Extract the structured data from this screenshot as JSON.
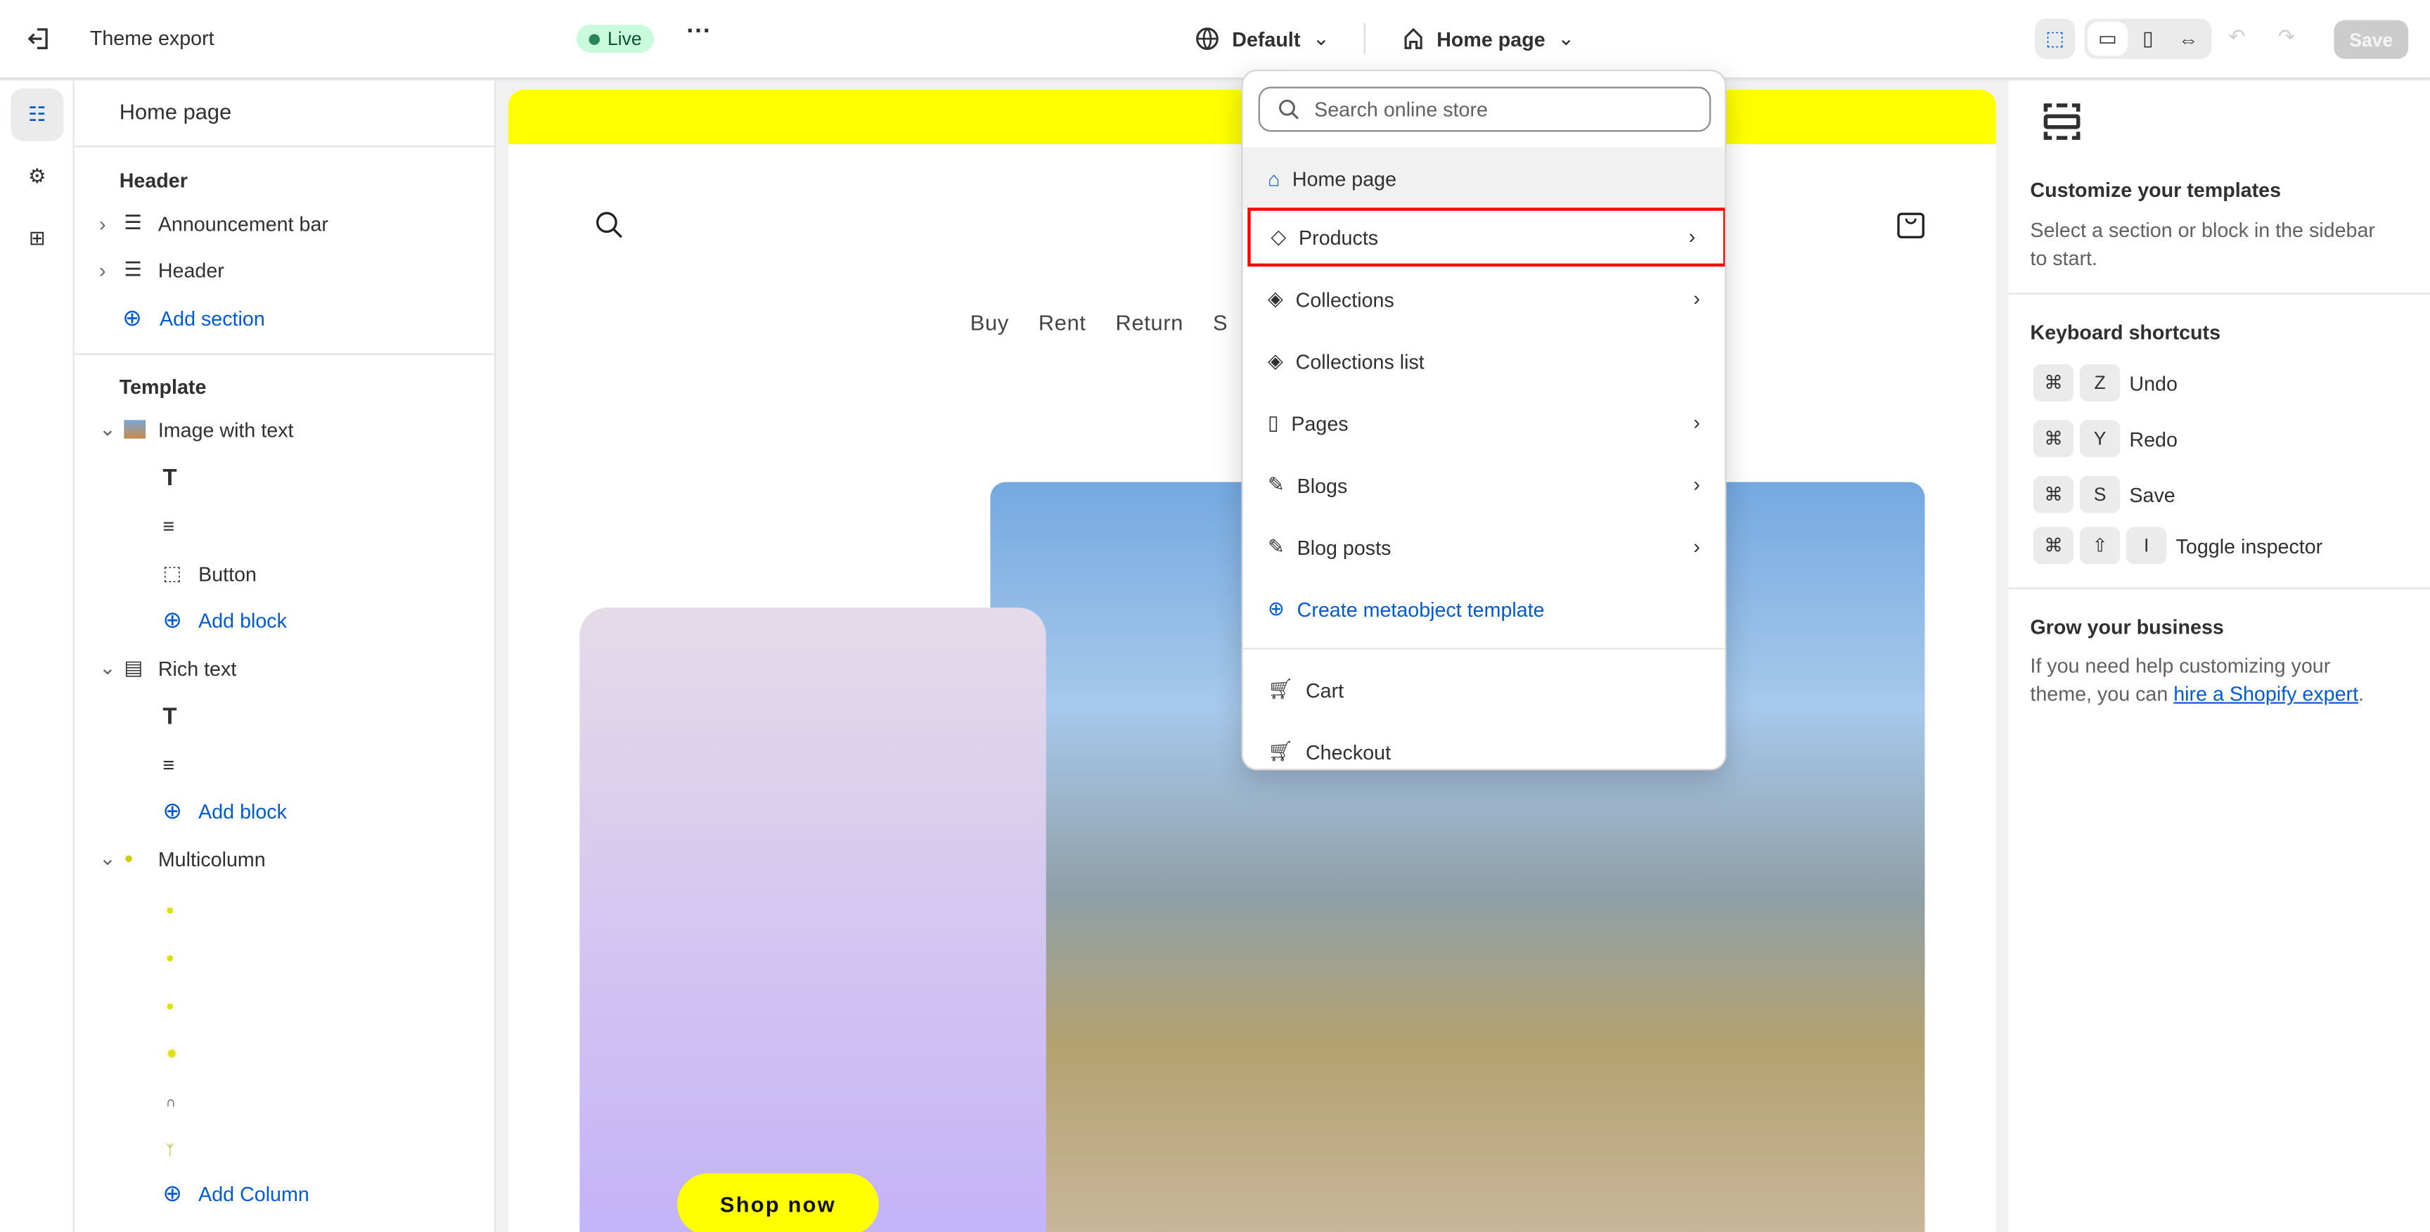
{
  "topbar": {
    "exit_icon": "exit-icon",
    "theme_name": "Theme export",
    "status": "Live",
    "more_icon": "ellipsis-icon",
    "locale": "Default",
    "template": "Home page",
    "save": "Save",
    "tools": [
      "inspector-icon",
      "desktop-icon",
      "mobile-icon",
      "fullwidth-icon",
      "undo-icon",
      "redo-icon"
    ]
  },
  "rail": {
    "items": [
      "sections-icon",
      "settings-icon",
      "apps-icon"
    ]
  },
  "sidebar": {
    "title": "Home page",
    "header_group": "Header",
    "header_items": [
      "Announcement bar",
      "Header"
    ],
    "add_section": "Add section",
    "template_group": "Template",
    "image_with_text": "Image with text",
    "iwt_blocks": [
      "heading-icon",
      "text-icon",
      "Button"
    ],
    "add_block": "Add block",
    "rich_text": "Rich text",
    "rt_blocks": [
      "heading-icon",
      "text-icon"
    ],
    "multicolumn": "Multicolumn",
    "columns": [
      "dollar-coin-icon",
      "check-circle-icon",
      "scale-icon",
      "gear-icon",
      "headset-icon",
      "sprout-icon"
    ],
    "add_column": "Add Column"
  },
  "preview": {
    "nav": [
      "Buy",
      "Rent",
      "Return",
      "S"
    ],
    "cta": "Shop now",
    "accent": "#ffff00"
  },
  "menu": {
    "search_placeholder": "Search online store",
    "items": [
      {
        "label": "Home page",
        "icon": "home-icon",
        "selected": true
      },
      {
        "label": "Products",
        "icon": "tag-icon",
        "submenu": true,
        "highlighted": true
      },
      {
        "label": "Collections",
        "icon": "tags-icon",
        "submenu": true
      },
      {
        "label": "Collections list",
        "icon": "tags-icon"
      },
      {
        "label": "Pages",
        "icon": "page-icon",
        "submenu": true
      },
      {
        "label": "Blogs",
        "icon": "blog-icon",
        "submenu": true
      },
      {
        "label": "Blog posts",
        "icon": "blog-icon",
        "submenu": true
      }
    ],
    "create": "Create metaobject template",
    "other": [
      {
        "label": "Cart",
        "icon": "cart-icon"
      },
      {
        "label": "Checkout",
        "icon": "cart-icon"
      }
    ]
  },
  "right": {
    "title": "Customize your templates",
    "desc": "Select a section or block in the sidebar to start.",
    "shortcuts_title": "Keyboard shortcuts",
    "shortcuts": [
      {
        "keys": [
          "⌘",
          "Z"
        ],
        "label": "Undo"
      },
      {
        "keys": [
          "⌘",
          "Y"
        ],
        "label": "Redo"
      },
      {
        "keys": [
          "⌘",
          "S"
        ],
        "label": "Save"
      },
      {
        "keys": [
          "⌘",
          "⇧",
          "I"
        ],
        "label": "Toggle inspector"
      }
    ],
    "grow_title": "Grow your business",
    "grow_text": "If you need help customizing your theme, you can ",
    "grow_link": "hire a Shopify expert",
    "grow_end": "."
  }
}
